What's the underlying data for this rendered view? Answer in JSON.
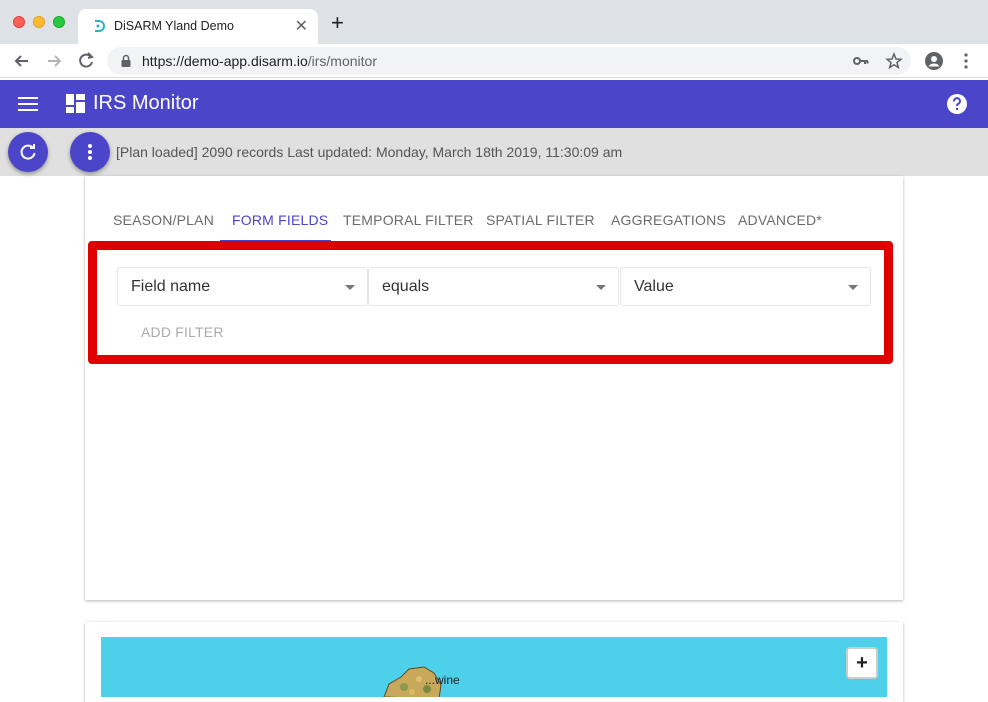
{
  "browser": {
    "tab_title": "DiSARM Yland Demo",
    "close_glyph": "✕",
    "new_tab_glyph": "+",
    "url_host": "https://demo-app.disarm.io",
    "url_path": "/irs/monitor",
    "icons": [
      "back-arrow-icon",
      "forward-arrow-icon",
      "reload-icon",
      "lock-icon",
      "key-icon",
      "star-icon",
      "profile-icon",
      "more-vert-icon"
    ]
  },
  "app": {
    "title": "IRS Monitor",
    "primary_color": "#4a45c9",
    "status_text": "[Plan loaded] 2090 records Last updated: Monday, March 18th 2019, 11:30:09 am"
  },
  "tabs": [
    {
      "label": "SEASON/PLAN",
      "active": false
    },
    {
      "label": "FORM FIELDS",
      "active": true
    },
    {
      "label": "TEMPORAL FILTER",
      "active": false
    },
    {
      "label": "SPATIAL FILTER",
      "active": false
    },
    {
      "label": "AGGREGATIONS",
      "active": false
    },
    {
      "label": "ADVANCED*",
      "active": false
    }
  ],
  "filter": {
    "field_label": "Field name",
    "operator_label": "equals",
    "value_label": "Value",
    "add_filter_label": "ADD FILTER",
    "highlight_color": "#e00000"
  },
  "map": {
    "zoom_in_label": "+",
    "partial_label": "...wine",
    "water_color": "#4dd0ea"
  }
}
